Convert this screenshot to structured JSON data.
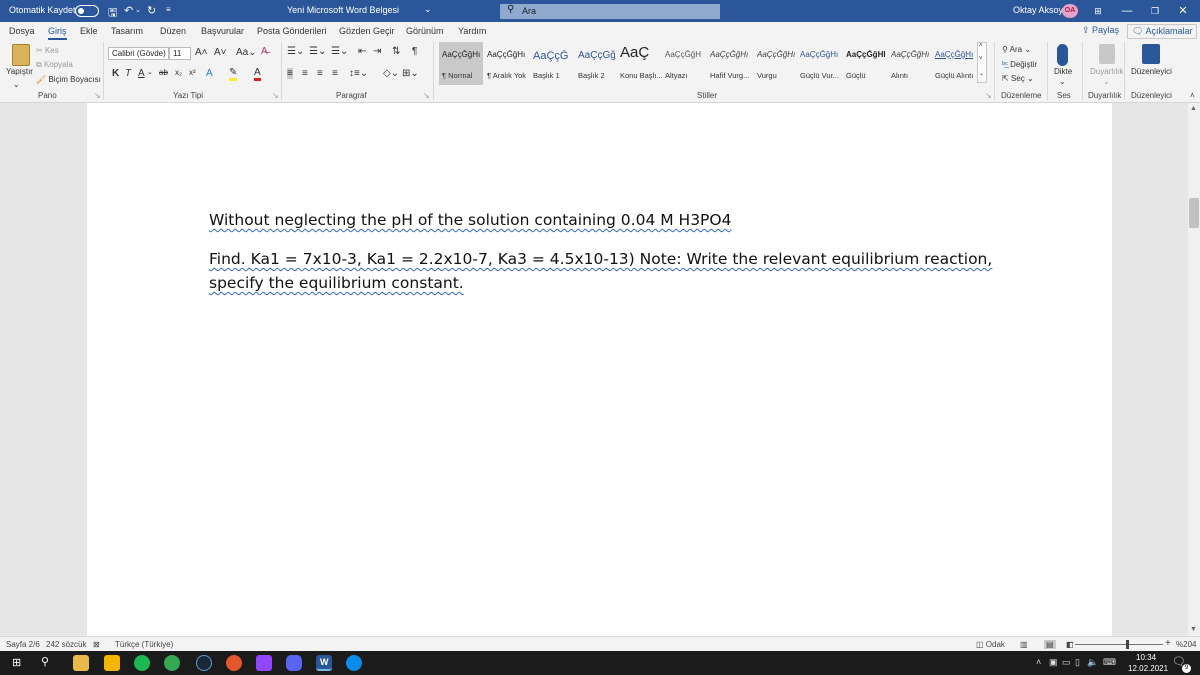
{
  "titlebar": {
    "autosave_label": "Otomatik Kaydet",
    "doc_title": "Yeni Microsoft Word Belgesi",
    "doc_title_caret": "⌄",
    "search_placeholder": "Ara",
    "user_name": "Oktay Aksoy",
    "user_initials": "OA"
  },
  "tabs": [
    "Dosya",
    "Giriş",
    "Ekle",
    "Tasarım",
    "Düzen",
    "Başvurular",
    "Posta Gönderileri",
    "Gözden Geçir",
    "Görünüm",
    "Yardım"
  ],
  "share_label": "Paylaş",
  "comments_label": "Açıklamalar",
  "ribbon": {
    "clipboard": {
      "paste": "Yapıştır",
      "cut": "Kes",
      "copy": "Kopyala",
      "format_painter": "Biçim Boyacısı",
      "label": "Pano"
    },
    "font": {
      "name": "Calibri (Gövde)",
      "size": "11",
      "label": "Yazı Tipi"
    },
    "paragraph_label": "Paragraf",
    "styles": {
      "label": "Stiller",
      "items": [
        {
          "preview": "AaÇçĞğHı",
          "name": "¶ Normal",
          "color": "#222222"
        },
        {
          "preview": "AaÇçĞğHı",
          "name": "¶ Aralık Yok",
          "color": "#222222"
        },
        {
          "preview": "AaÇçĞ",
          "name": "Başlık 1",
          "color": "#2f5496"
        },
        {
          "preview": "AaÇçĞğh",
          "name": "Başlık 2",
          "color": "#2f5496"
        },
        {
          "preview": "AaÇ",
          "name": "Konu Başlı...",
          "color": "#222222"
        },
        {
          "preview": "AaÇçĞğH",
          "name": "Altyazı",
          "color": "#595959"
        },
        {
          "preview": "AaÇçĞğHı",
          "name": "Hafif Vurg...",
          "color": "#404040"
        },
        {
          "preview": "AaÇçĞğHı",
          "name": "Vurgu",
          "color": "#404040"
        },
        {
          "preview": "AaÇçĞğHı",
          "name": "Güçlü Vur...",
          "color": "#2f5496"
        },
        {
          "preview": "AaÇçĞğHI",
          "name": "Güçlü",
          "color": "#222222"
        },
        {
          "preview": "AaÇçĞğHı",
          "name": "Alıntı",
          "color": "#404040"
        },
        {
          "preview": "AaÇçĞğHı",
          "name": "Güçlü Alıntı",
          "color": "#2f5496"
        }
      ]
    },
    "editing": {
      "find": "Ara",
      "replace": "Değiştir",
      "select": "Seç",
      "label": "Düzenleme"
    },
    "voice": {
      "dictate": "Dikte",
      "label": "Ses"
    },
    "sensitivity": {
      "button": "Duyarlılık",
      "label": "Duyarlılık"
    },
    "editor": {
      "button": "Düzenleyici",
      "label": "Düzenleyici"
    }
  },
  "document": {
    "lines": [
      "Without neglecting the pH of the solution containing 0.04 M H3PO4",
      "Find. Ka1 = 7x10-3, Ka1 = 2.2x10-7, Ka3 = 4.5x10-13) Note: Write the relevant equilibrium reaction,",
      "specify the equilibrium constant."
    ]
  },
  "statusbar": {
    "page": "Sayfa 2/6",
    "words": "242 sözcük",
    "language": "Türkçe (Türkiye)",
    "focus": "Odak",
    "zoom": "%204",
    "zoom_minus": "−",
    "zoom_plus": "+"
  },
  "taskbar": {
    "time": "10:34",
    "date": "12.02.2021",
    "word_badge": "W",
    "notification_count": "9"
  },
  "colors": {
    "accent": "#2b579a",
    "spell_underline": "#2f6ad1"
  }
}
